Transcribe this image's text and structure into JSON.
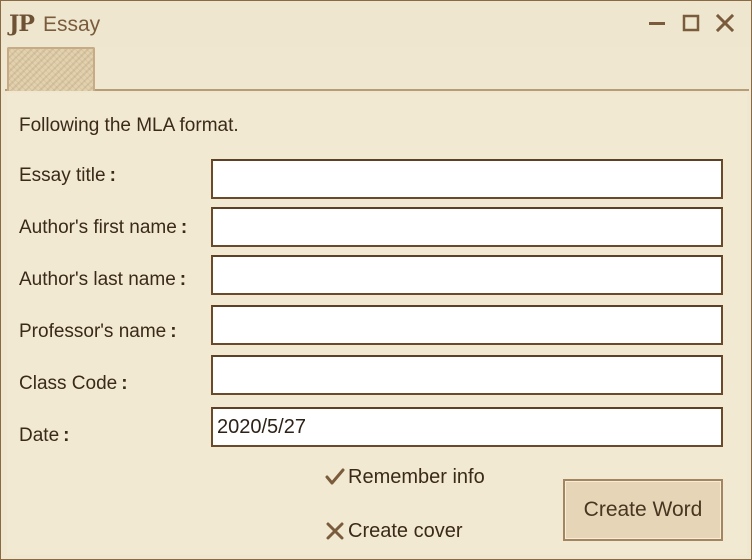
{
  "app": {
    "logo_text": "JP",
    "title": "Essay"
  },
  "form": {
    "intro": "Following the MLA format.",
    "fields": [
      {
        "label": "Essay title",
        "value": ""
      },
      {
        "label": "Author's first name",
        "value": ""
      },
      {
        "label": "Author's last name",
        "value": ""
      },
      {
        "label": "Professor's name",
        "value": ""
      },
      {
        "label": "Class Code",
        "value": ""
      },
      {
        "label": "Date",
        "value": "2020/5/27"
      }
    ],
    "colon": ":"
  },
  "options": {
    "remember": {
      "label": "Remember info",
      "checked": true,
      "icon": "checkmark-icon"
    },
    "cover": {
      "label": "Create cover",
      "checked": false,
      "icon": "cross-icon"
    }
  },
  "actions": {
    "create_label": "Create Word"
  },
  "colors": {
    "background": "#f0e7d1",
    "border": "#6a4a2a",
    "text": "#3a2a18",
    "accent": "#8a6a44"
  }
}
